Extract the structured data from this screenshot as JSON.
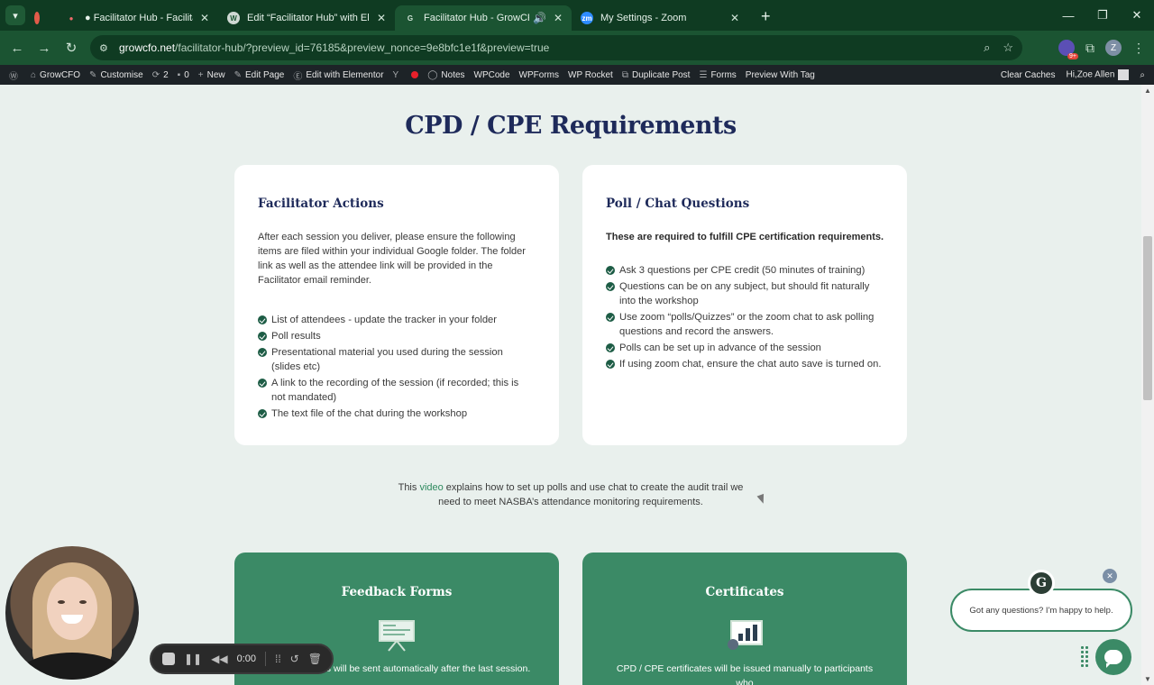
{
  "browser": {
    "tabs": [
      {
        "title": "",
        "icon": "record-icon",
        "active": false
      },
      {
        "title": "● Facilitator Hub - Facilitator Hu",
        "icon": "asana-icon",
        "active": false
      },
      {
        "title": "Edit “Facilitator Hub” with Elem",
        "icon": "wordpress-icon",
        "active": false
      },
      {
        "title": "Facilitator Hub - GrowCFO",
        "icon": "growcfo-icon",
        "active": true
      },
      {
        "title": "My Settings - Zoom",
        "icon": "zoom-icon",
        "active": false
      }
    ],
    "url_host": "growcfo.net",
    "url_path": "/facilitator-hub/?preview_id=76185&preview_nonce=9e8bfc1e1f&preview=true",
    "profile_initial": "Z"
  },
  "adminbar": {
    "site": "GrowCFO",
    "customise": "Customise",
    "updates": "2",
    "comments": "0",
    "new": "New",
    "edit_page": "Edit Page",
    "elementor": "Edit with Elementor",
    "notes": "Notes",
    "wpcode": "WPCode",
    "wpforms": "WPForms",
    "wprocket": "WP Rocket",
    "duplicate": "Duplicate Post",
    "forms": "Forms",
    "preview_tag": "Preview With Tag",
    "clear_caches": "Clear Caches",
    "greeting": "Hi,Zoe Allen"
  },
  "page": {
    "title": "CPD / CPE Requirements",
    "facilitator": {
      "heading": "Facilitator Actions",
      "intro": "After each session you deliver, please ensure the following items are filed within your individual Google folder. The folder link as well as the attendee link will be provided in the Facilitator email reminder.",
      "items": [
        "List of attendees - update the tracker in your folder",
        "Poll results",
        "Presentational material you used during the session (slides etc)",
        "A link to the recording of the session (if recorded; this is not mandated)",
        "The text file of the chat during the workshop"
      ]
    },
    "poll": {
      "heading": "Poll / Chat Questions",
      "intro": "These are required to fulfill CPE certification requirements.",
      "items": [
        "Ask 3 questions per CPE credit (50 minutes of training)",
        "Questions can be on any subject, but should fit naturally into the workshop",
        "Use zoom “polls/Quizzes” or the zoom chat to ask polling questions and record the answers.",
        "Polls can be set up in advance of the session",
        "If using zoom chat, ensure the chat auto save is turned on."
      ]
    },
    "video_note": {
      "before": "This ",
      "link": "video",
      "after": " explains how to set up polls and use chat to create the audit trail we need to meet NASBA’s attendance monitoring requirements."
    },
    "feedback": {
      "heading": "Feedback Forms",
      "text": "Feedback forms will be sent automatically after the last session."
    },
    "certificates": {
      "heading": "Certificates",
      "text": "CPD / CPE certificates will be issued manually to participants who"
    }
  },
  "recorder": {
    "time": "0:00"
  },
  "chat": {
    "bubble": "Got any questions? I'm happy to help.",
    "logo_letter": "G"
  }
}
